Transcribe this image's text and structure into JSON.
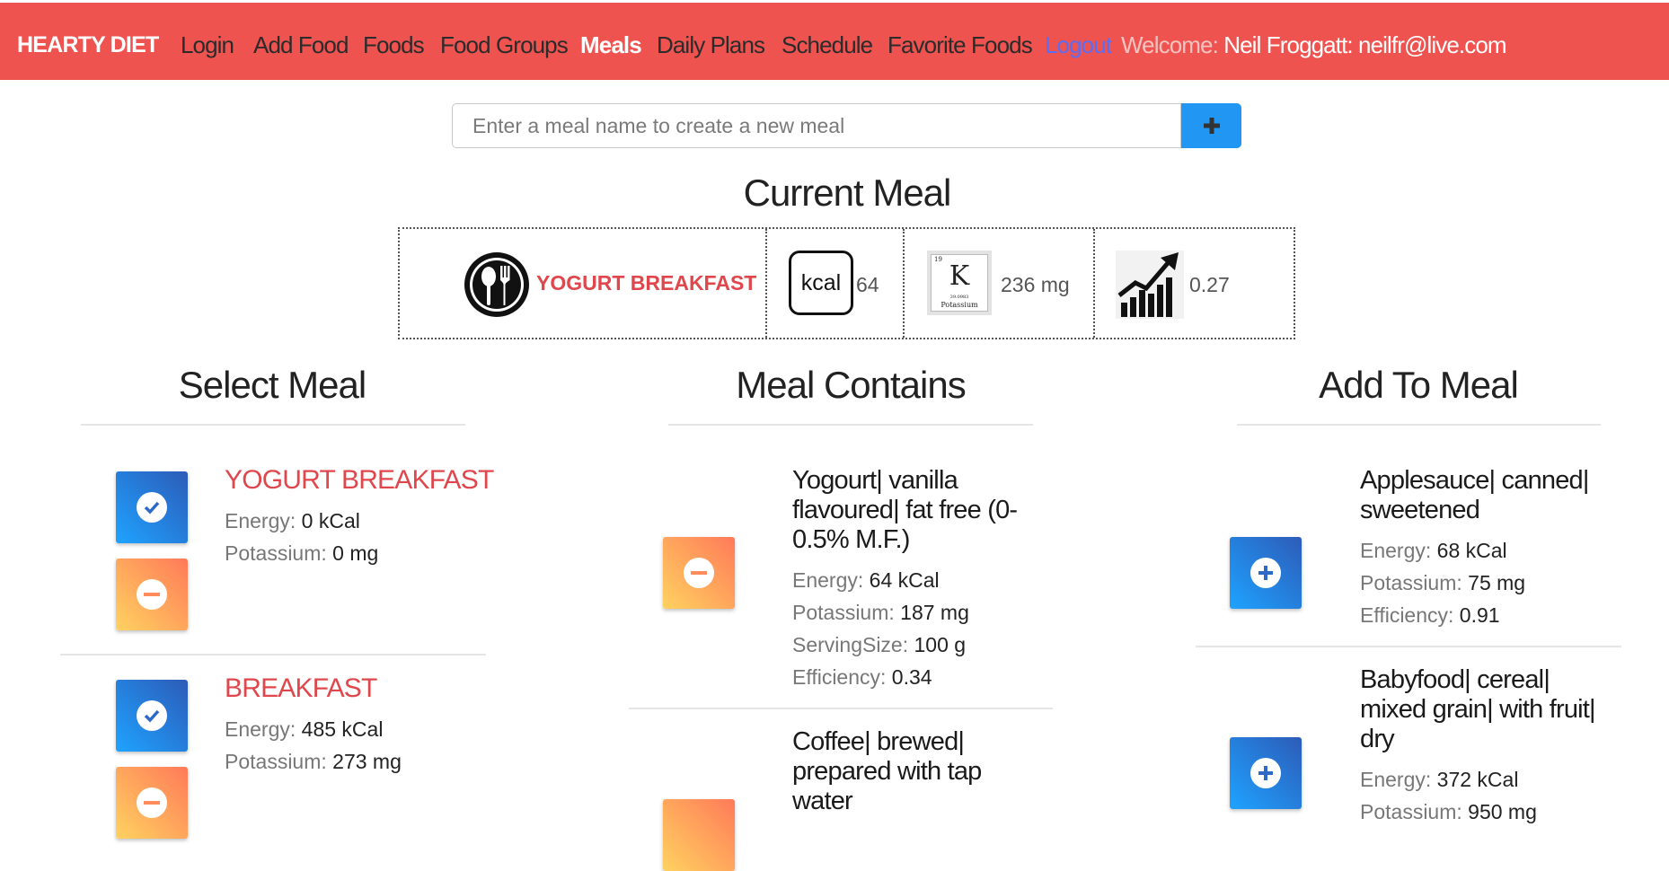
{
  "nav": {
    "brand": "HEARTY DIET",
    "items": [
      "Login",
      "Add Food",
      "Foods",
      "Food Groups",
      "Meals",
      "Daily Plans",
      "Schedule",
      "Favorite Foods"
    ],
    "active": "Meals",
    "logout": "Logout",
    "welcome_label": "Welcome:",
    "user": "Neil Froggatt: neilfr@live.com"
  },
  "new_meal": {
    "placeholder": "Enter a meal name to create a new meal",
    "add_icon": "plus-icon"
  },
  "current_meal": {
    "title": "Current Meal",
    "name": "YOGURT BREAKFAST",
    "energy": "64",
    "potassium": "236 mg",
    "efficiency": "0.27",
    "icons": [
      "meal-icon",
      "kcal-icon",
      "potassium-icon",
      "efficiency-chart-icon"
    ],
    "kcal_icon_text": "kcal",
    "k_symbol": "K",
    "k_number": "19",
    "k_weight": "39.0983",
    "k_label": "Potassium"
  },
  "select_meal": {
    "title": "Select Meal",
    "meals": [
      {
        "name": "YOGURT BREAKFAST",
        "energy_label": "Energy:",
        "energy": "0 kCal",
        "potassium_label": "Potassium:",
        "potassium": "0 mg"
      },
      {
        "name": "BREAKFAST",
        "energy_label": "Energy:",
        "energy": "485 kCal",
        "potassium_label": "Potassium:",
        "potassium": "273 mg"
      }
    ]
  },
  "meal_contains": {
    "title": "Meal Contains",
    "items": [
      {
        "name": "Yogourt| vanilla flavoured| fat free (0-0.5% M.F.)",
        "energy_label": "Energy:",
        "energy": "64 kCal",
        "potassium_label": "Potassium:",
        "potassium": "187 mg",
        "serving_label": "ServingSize:",
        "serving": "100 g",
        "efficiency_label": "Efficiency:",
        "efficiency": "0.34"
      },
      {
        "name": "Coffee| brewed| prepared with tap water"
      }
    ]
  },
  "add_to_meal": {
    "title": "Add To Meal",
    "items": [
      {
        "name": "Applesauce| canned| sweetened",
        "energy_label": "Energy:",
        "energy": "68 kCal",
        "potassium_label": "Potassium:",
        "potassium": "75 mg",
        "efficiency_label": "Efficiency:",
        "efficiency": "0.91"
      },
      {
        "name": "Babyfood| cereal| mixed grain| with fruit| dry",
        "energy_label": "Energy:",
        "energy": "372 kCal",
        "potassium_label": "Potassium:",
        "potassium": "950 mg"
      }
    ]
  },
  "colors": {
    "navbar": "#ef5350",
    "accent_red": "#e0474c",
    "primary_blue": "#2196f3",
    "active_nav": "#ffffff",
    "logout": "#5a6df5"
  }
}
